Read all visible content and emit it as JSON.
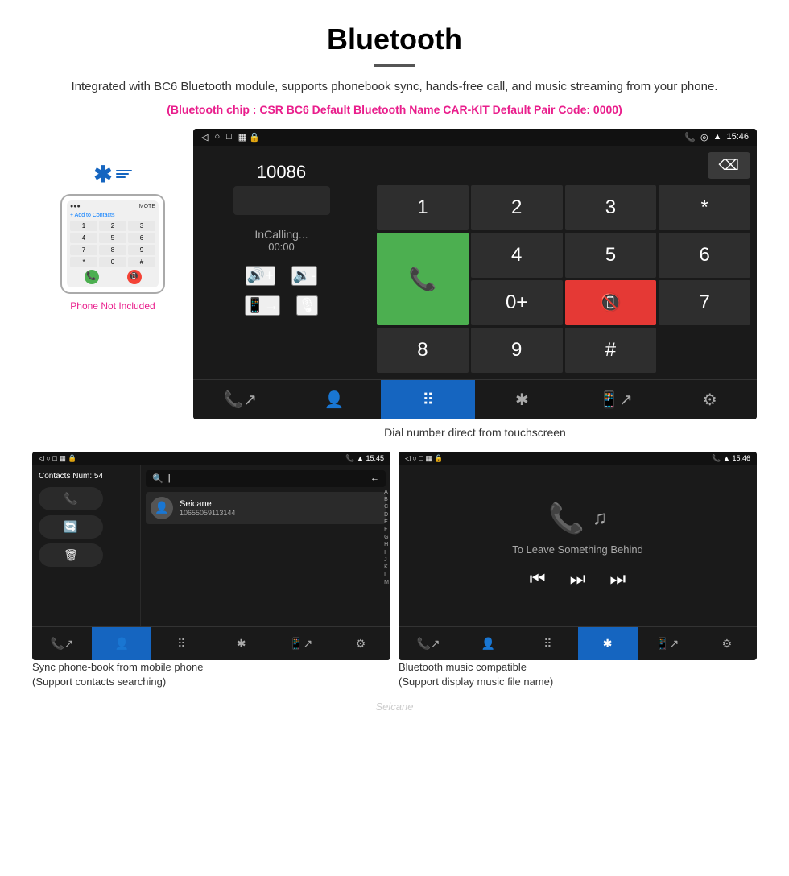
{
  "header": {
    "title": "Bluetooth",
    "description": "Integrated with BC6 Bluetooth module, supports phonebook sync, hands-free call, and music streaming from your phone.",
    "chip_info": "(Bluetooth chip : CSR BC6    Default Bluetooth Name CAR-KIT    Default Pair Code: 0000)"
  },
  "phone_section": {
    "not_included_label": "Phone Not Included"
  },
  "dial_screen": {
    "status_bar": {
      "left_icons": [
        "back",
        "home",
        "recents",
        "notifications"
      ],
      "time": "15:46",
      "right_icons": [
        "phone",
        "location",
        "wifi",
        "battery"
      ]
    },
    "number": "10086",
    "incalling": "InCalling...",
    "timer": "00:00",
    "numpad": {
      "keys": [
        "1",
        "2",
        "3",
        "*",
        "4",
        "5",
        "6",
        "0+",
        "7",
        "8",
        "9",
        "#"
      ],
      "call_btn": "📞",
      "end_btn": "📞"
    },
    "caption": "Dial number direct from touchscreen"
  },
  "contacts_screen": {
    "status_time": "15:45",
    "contacts_num": "Contacts Num: 54",
    "search_placeholder": "Search",
    "contact": {
      "name": "Seicane",
      "number": "10655059113144"
    },
    "alpha_index": [
      "A",
      "B",
      "C",
      "D",
      "E",
      "F",
      "G",
      "H",
      "I",
      "J",
      "K",
      "L",
      "M"
    ],
    "action_btns": [
      "call",
      "refresh",
      "delete"
    ],
    "bottom_nav": {
      "items": [
        "call-transfer",
        "contacts",
        "dialpad",
        "bluetooth",
        "phone-out",
        "settings"
      ],
      "active": "contacts"
    },
    "caption": "Sync phone-book from mobile phone\n(Support contacts searching)"
  },
  "music_screen": {
    "status_time": "15:46",
    "song_title": "To Leave Something Behind",
    "controls": [
      "prev",
      "play-pause",
      "next"
    ],
    "bottom_nav": {
      "items": [
        "call-transfer",
        "contacts",
        "dialpad",
        "bluetooth",
        "phone-out",
        "settings"
      ],
      "active": "bluetooth"
    },
    "caption": "Bluetooth music compatible\n(Support display music file name)"
  },
  "watermark": "Seicane",
  "colors": {
    "accent_blue": "#1565C0",
    "accent_pink": "#e91e8c",
    "green": "#4CAF50",
    "red": "#e53935",
    "dark_bg": "#1a1a1a",
    "status_bar": "#111"
  }
}
